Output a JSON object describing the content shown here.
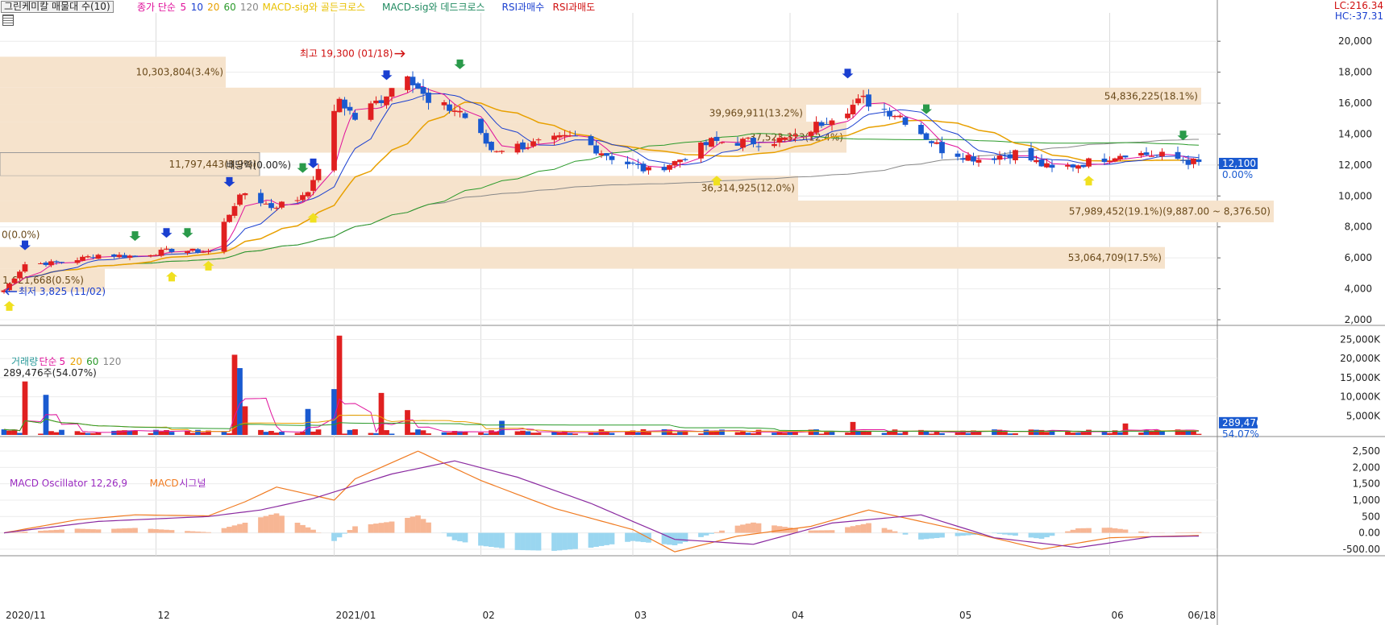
{
  "header": {
    "title_button": "그린케미칼 매물대 수(10)",
    "legend": [
      {
        "label": "종가 단순",
        "color": "#e0119b"
      },
      {
        "label": "5",
        "color": "#e0119b"
      },
      {
        "label": "10",
        "color": "#1a3fd0"
      },
      {
        "label": "20",
        "color": "#e8a000"
      },
      {
        "label": "60",
        "color": "#2a9a2a"
      },
      {
        "label": "120",
        "color": "#888888"
      },
      {
        "label": "MACD-sig와 골든크로스",
        "color": "#e8c000"
      },
      {
        "label": "MACD-sig와 데드크로스",
        "color": "#208a60"
      },
      {
        "label": "RSI과매수",
        "color": "#1a3fd0"
      },
      {
        "label": "RSI과매도",
        "color": "#d01010"
      }
    ],
    "lc": "LC:216.34",
    "hc": "HC:-37.31"
  },
  "colors": {
    "up": "#e02020",
    "down": "#1a5ad0",
    "ma5": "#e0119b",
    "ma10": "#1a3fd0",
    "ma20": "#e8a000",
    "ma60": "#2a9a2a",
    "ma120": "#888888",
    "band": "#f6e3cc",
    "macd": "#f07a20",
    "signal": "#8a2aa0",
    "osc_pos": "#f7b694",
    "osc_neg": "#9ad6f0"
  },
  "x_axis": {
    "labels": [
      "2020/11",
      "12",
      "2021/01",
      "02",
      "03",
      "04",
      "05",
      "06",
      "06/18"
    ]
  },
  "panels": {
    "price": {
      "ticks": [
        "20,000",
        "18,000",
        "16,000",
        "14,000",
        "12,000",
        "10,000",
        "8,000",
        "6,000",
        "4,000",
        "2,000"
      ],
      "current_badge": "12,100",
      "current_pct": "0.00%"
    },
    "volume": {
      "legend": [
        "거래량",
        "단순",
        "5",
        "20",
        "60",
        "120"
      ],
      "current_label": "289,476주(54.07%)",
      "ticks": [
        "25,000K",
        "20,000K",
        "15,000K",
        "10,000K",
        "5,000K"
      ],
      "current_badge": "289,476",
      "current_pct": "54.07%"
    },
    "macd": {
      "legend": [
        "MACD Oscillator 12,26,9",
        "MACD",
        "시그널"
      ],
      "ticks": [
        "2,500",
        "2,000",
        "1,500",
        "1,000",
        "500",
        "0.00",
        "-500.00"
      ]
    }
  },
  "annotations": {
    "high": "최고 19,300 (01/18)",
    "low": "최저 3,825 (11/02)",
    "dividend": "배당락(0.00%)"
  },
  "chart_data": {
    "type": "candlestick",
    "title": "그린케미칼 매물대 수(10)",
    "period": {
      "start": "2020/11/02",
      "end": "2021/06/18"
    },
    "price_range": [
      2000,
      21000
    ],
    "high": {
      "value": 19300,
      "date": "01/18"
    },
    "low": {
      "value": 3825,
      "date": "11/02"
    },
    "last_close": 12100,
    "close_series": [
      [
        "2020/11/02",
        3900
      ],
      [
        "2020/11/06",
        5600
      ],
      [
        "2020/11/13",
        5700
      ],
      [
        "2020/11/20",
        6200
      ],
      [
        "2020/11/27",
        6100
      ],
      [
        "2020/12/04",
        6500
      ],
      [
        "2020/12/11",
        6400
      ],
      [
        "2020/12/16",
        9500
      ],
      [
        "2020/12/18",
        10200
      ],
      [
        "2020/12/23",
        9300
      ],
      [
        "2020/12/28",
        9800
      ],
      [
        "2020/12/31",
        10800
      ],
      [
        "2021/01/05",
        16300
      ],
      [
        "2021/01/08",
        15000
      ],
      [
        "2021/01/13",
        16300
      ],
      [
        "2021/01/18",
        18100
      ],
      [
        "2021/01/22",
        15900
      ],
      [
        "2021/01/28",
        15500
      ],
      [
        "2021/02/03",
        13000
      ],
      [
        "2021/02/10",
        13300
      ],
      [
        "2021/02/19",
        13800
      ],
      [
        "2021/02/26",
        12500
      ],
      [
        "2021/03/05",
        11600
      ],
      [
        "2021/03/10",
        12200
      ],
      [
        "2021/03/17",
        13500
      ],
      [
        "2021/03/26",
        13500
      ],
      [
        "2021/04/02",
        13700
      ],
      [
        "2021/04/09",
        15200
      ],
      [
        "2021/04/15",
        16200
      ],
      [
        "2021/04/22",
        15200
      ],
      [
        "2021/04/30",
        13000
      ],
      [
        "2021/05/07",
        12400
      ],
      [
        "2021/05/14",
        12800
      ],
      [
        "2021/05/21",
        11700
      ],
      [
        "2021/05/28",
        12200
      ],
      [
        "2021/06/04",
        12800
      ],
      [
        "2021/06/11",
        12600
      ],
      [
        "2021/06/18",
        12100
      ]
    ],
    "volume_profile": [
      {
        "label": "10,303,804(3.4%)",
        "from": 17000,
        "to": 19000
      },
      {
        "label": "54,836,225(18.1%)",
        "from": 15900,
        "to": 17000
      },
      {
        "label": "39,969,911(13.2%)",
        "from": 14800,
        "to": 15900
      },
      {
        "label": "37,523,323(12.4%)",
        "from": 12800,
        "to": 14800
      },
      {
        "label": "11,797,443(3.9%)",
        "from": 11300,
        "to": 12800
      },
      {
        "label": "36,314,925(12.0%)",
        "from": 9700,
        "to": 11300
      },
      {
        "label": "57,989,452(19.1%)(9,887.00 ~ 8,376.50)",
        "from": 8300,
        "to": 9700
      },
      {
        "label": "0(0.0%)",
        "from": 6700,
        "to": 8300
      },
      {
        "label": "53,064,709(17.5%)",
        "from": 5300,
        "to": 6700
      },
      {
        "label": "1,621,668(0.5%)",
        "from": 3800,
        "to": 5300
      }
    ],
    "volume_range": [
      0,
      27000
    ],
    "volume_bars": [
      [
        "2020/11/06",
        14000
      ],
      [
        "2020/11/10",
        10500
      ],
      [
        "2020/12/16",
        21000
      ],
      [
        "2020/12/17",
        17500
      ],
      [
        "2020/12/18",
        7500
      ],
      [
        "2020/12/30",
        6800
      ],
      [
        "2021/01/04",
        12000
      ],
      [
        "2021/01/05",
        26000
      ],
      [
        "2021/01/13",
        11000
      ],
      [
        "2021/01/18",
        6500
      ],
      [
        "2021/02/05",
        3700
      ],
      [
        "2021/04/13",
        3400
      ],
      [
        "2021/06/04",
        3000
      ],
      [
        "2021/06/18",
        289.476
      ]
    ],
    "macd_range": [
      -700,
      2600
    ],
    "macd_series": [
      [
        "2020/11/02",
        0
      ],
      [
        "2020/11/16",
        400
      ],
      [
        "2020/11/27",
        550
      ],
      [
        "2020/12/11",
        520
      ],
      [
        "2020/12/18",
        950
      ],
      [
        "2020/12/24",
        1400
      ],
      [
        "2021/01/04",
        1000
      ],
      [
        "2021/01/08",
        1650
      ],
      [
        "2021/01/20",
        2500
      ],
      [
        "2021/02/01",
        1600
      ],
      [
        "2021/02/15",
        750
      ],
      [
        "2021/03/02",
        100
      ],
      [
        "2021/03/10",
        -580
      ],
      [
        "2021/03/22",
        -100
      ],
      [
        "2021/04/05",
        200
      ],
      [
        "2021/04/16",
        700
      ],
      [
        "2021/05/03",
        100
      ],
      [
        "2021/05/19",
        -500
      ],
      [
        "2021/06/01",
        -150
      ],
      [
        "2021/06/18",
        -80
      ]
    ],
    "signal_series": [
      [
        "2020/11/02",
        0
      ],
      [
        "2020/11/20",
        350
      ],
      [
        "2020/12/11",
        500
      ],
      [
        "2020/12/21",
        700
      ],
      [
        "2020/12/31",
        1050
      ],
      [
        "2021/01/15",
        1800
      ],
      [
        "2021/01/27",
        2200
      ],
      [
        "2021/02/08",
        1700
      ],
      [
        "2021/02/22",
        900
      ],
      [
        "2021/03/10",
        -200
      ],
      [
        "2021/03/25",
        -350
      ],
      [
        "2021/04/09",
        300
      ],
      [
        "2021/04/26",
        550
      ],
      [
        "2021/05/10",
        -150
      ],
      [
        "2021/05/26",
        -450
      ],
      [
        "2021/06/09",
        -120
      ],
      [
        "2021/06/18",
        -100
      ]
    ]
  }
}
